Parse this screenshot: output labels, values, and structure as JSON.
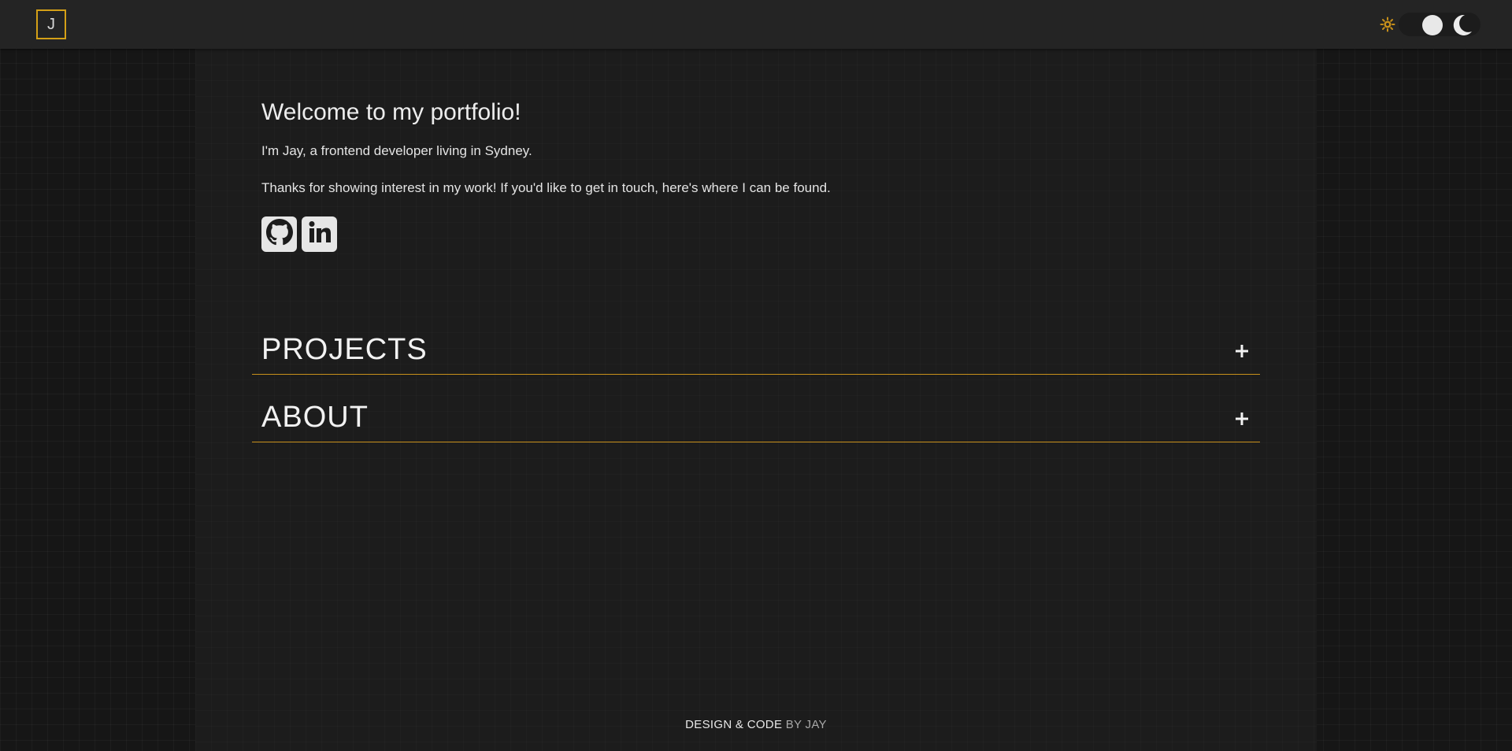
{
  "header": {
    "logo_letter": "J",
    "accent_color": "#d4a017"
  },
  "theme_toggle": {
    "icons": [
      "sun-icon",
      "moon-icon"
    ],
    "current": "dark"
  },
  "intro": {
    "title": "Welcome to my portfolio!",
    "line1": "I'm Jay, a frontend developer living in Sydney.",
    "line2": "Thanks for showing interest in my work! If you'd like to get in touch, here's where I can be found."
  },
  "socials": [
    {
      "icon": "github-icon"
    },
    {
      "icon": "linkedin-icon"
    }
  ],
  "sections": [
    {
      "label": "PROJECTS",
      "expanded": false
    },
    {
      "label": "ABOUT",
      "expanded": false
    }
  ],
  "footer": {
    "main": "DESIGN & CODE",
    "by": "BY JAY"
  }
}
